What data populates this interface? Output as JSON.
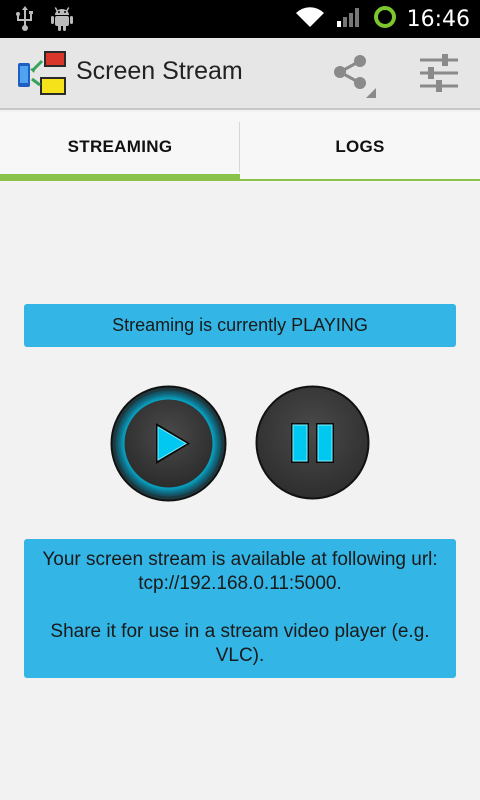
{
  "status_bar": {
    "time": "16:46",
    "icons": [
      "usb-icon",
      "android-debug-icon",
      "wifi-icon",
      "signal-icon",
      "sync-ring-icon"
    ]
  },
  "action_bar": {
    "title": "Screen Stream",
    "share_icon": "share-icon",
    "settings_icon": "settings-sliders-icon"
  },
  "tabs": [
    {
      "label": "STREAMING",
      "selected": true
    },
    {
      "label": "LOGS",
      "selected": false
    }
  ],
  "main": {
    "status_text": "Streaming is currently PLAYING",
    "play_icon": "play-icon",
    "pause_icon": "pause-icon",
    "info_line1": "Your screen stream is available at following url: tcp://192.168.0.11:5000.",
    "info_line2": "Share it for use in a stream video player (e.g. VLC)."
  },
  "colors": {
    "accent_blue": "#33b5e5",
    "tab_green": "#8bc34a",
    "glow_cyan": "#00d8ff"
  }
}
